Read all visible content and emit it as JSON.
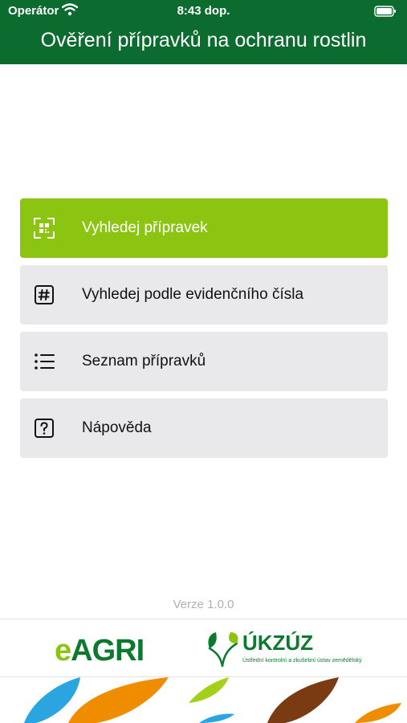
{
  "status": {
    "carrier": "Operátor",
    "time": "8:43 dop."
  },
  "header": {
    "title": "Ověření přípravků na ochranu rostlin"
  },
  "menu": {
    "items": [
      {
        "label": "Vyhledej přípravek",
        "icon": "qr-scan-icon"
      },
      {
        "label": "Vyhledej podle evidenčního čísla",
        "icon": "hash-icon"
      },
      {
        "label": "Seznam přípravků",
        "icon": "list-icon"
      },
      {
        "label": "Nápověda",
        "icon": "help-icon"
      }
    ]
  },
  "footer": {
    "version": "Verze 1.0.0",
    "eagri_e": "e",
    "eagri_rest": "AGRI",
    "ukzuz_name": "ÚKZÚZ",
    "ukzuz_subtitle": "Ústřední kontrolní a zkušební ústav zemědělský"
  },
  "colors": {
    "brand_green": "#0c6b2e",
    "accent_lime": "#8cc412",
    "button_gray": "#e9e9eb"
  }
}
